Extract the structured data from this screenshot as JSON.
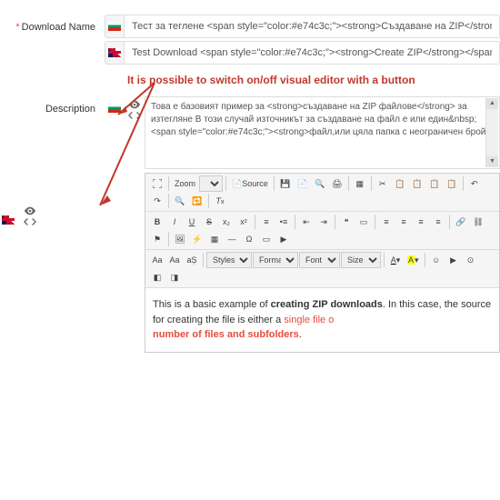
{
  "fields": {
    "download_name": {
      "label": "Download Name",
      "required": true
    },
    "description": {
      "label": "Description",
      "required": false
    }
  },
  "download_name": {
    "bg": "Тест за теглене <span style=\"color:#e74c3c;\"><strong>Създаване на ZIP</strong></span>",
    "en": "Test Download <span style=\"color:#e74c3c;\"><strong>Create ZIP</strong></span>"
  },
  "description_source": {
    "bg": "Това е базовият пример за <strong>създаване на ZIP файлове</strong> за\nизтегляне В този случай източникът за създаване на файл е или един&nbsp;\n<span style=\"color:#e74c3c;\"><strong>файл,или цяла папка с неограничен брой"
  },
  "annotation": "It is possible to switch on/off visual editor with a button",
  "editor": {
    "zoom_label": "Zoom",
    "source_label": "Source",
    "styles_label": "Styles",
    "format_label": "Format",
    "font_label": "Font",
    "size_label": "Size",
    "content_plain_pre": "This is a basic example of ",
    "content_bold": "creating ZIP downloads",
    "content_plain_mid": ". In this case, the source for creating the file is either a ",
    "content_red1": "single file o",
    "content_red2": "number of files and subfolders",
    "content_period": "."
  }
}
